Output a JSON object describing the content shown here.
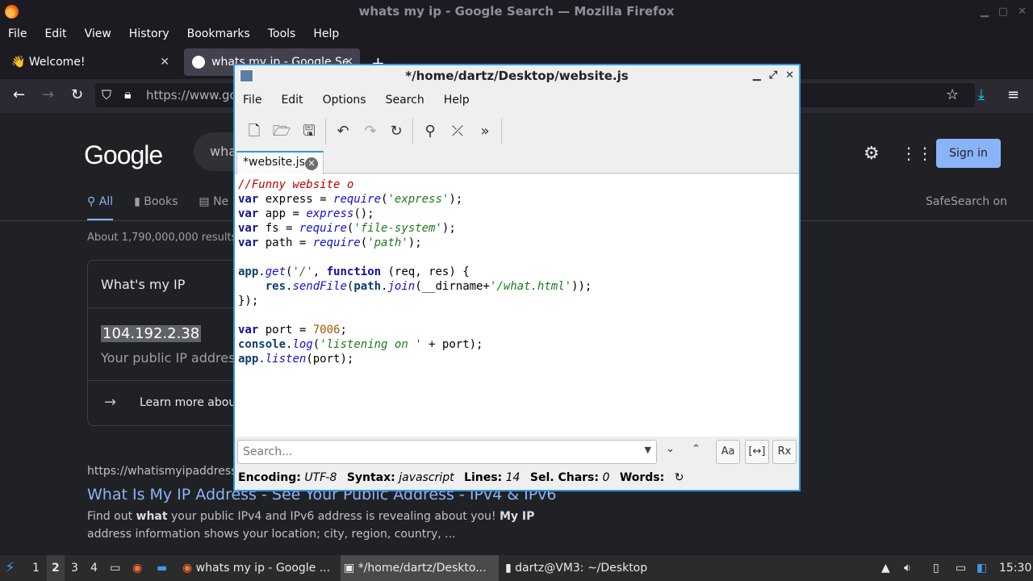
{
  "firefox": {
    "window_title": "whats my ip - Google Search — Mozilla Firefox",
    "menu": [
      "File",
      "Edit",
      "View",
      "History",
      "Bookmarks",
      "Tools",
      "Help"
    ],
    "tabs": [
      {
        "label": "👋 Welcome!"
      },
      {
        "label": "whats my ip - Google Se"
      }
    ],
    "url": "https://www.goo"
  },
  "google": {
    "logo": "Google",
    "search_value": "wha",
    "sign_in": "Sign in",
    "tabs": [
      "All",
      "Books",
      "Ne"
    ],
    "safesearch": "SafeSearch on",
    "results_count": "About 1,790,000,000 results",
    "card": {
      "title": "What's my IP",
      "ip": "104.192.2.38",
      "subtitle": "Your public IP address",
      "learn_more": "Learn more about"
    },
    "result": {
      "url": "https://whatismyipaddress.co",
      "title": "What Is My IP Address - See Your Public Address - IPv4 & IPv6",
      "snippet_parts": [
        "Find out ",
        "what",
        " your public IPv4 and IPv6 address is revealing about you! ",
        "My IP",
        " address information shows your location; city, region, country, ..."
      ]
    }
  },
  "editor": {
    "title": "*/home/dartz/Desktop/website.js",
    "menu": [
      "File",
      "Edit",
      "Options",
      "Search",
      "Help"
    ],
    "tab_label": "*website.js",
    "code_lines": [
      [
        {
          "t": "cm",
          "v": "//Funny website o"
        }
      ],
      [
        {
          "t": "kw",
          "v": "var"
        },
        {
          "t": "",
          "v": " express = "
        },
        {
          "t": "fn",
          "v": "require"
        },
        {
          "t": "",
          "v": "("
        },
        {
          "t": "st",
          "v": "'express'"
        },
        {
          "t": "",
          "v": ");"
        }
      ],
      [
        {
          "t": "kw",
          "v": "var"
        },
        {
          "t": "",
          "v": " app = "
        },
        {
          "t": "fn",
          "v": "express"
        },
        {
          "t": "",
          "v": "();"
        }
      ],
      [
        {
          "t": "kw",
          "v": "var"
        },
        {
          "t": "",
          "v": " fs = "
        },
        {
          "t": "fn",
          "v": "require"
        },
        {
          "t": "",
          "v": "("
        },
        {
          "t": "st",
          "v": "'file-system'"
        },
        {
          "t": "",
          "v": ");"
        }
      ],
      [
        {
          "t": "kw",
          "v": "var"
        },
        {
          "t": "",
          "v": " path = "
        },
        {
          "t": "fn",
          "v": "require"
        },
        {
          "t": "",
          "v": "("
        },
        {
          "t": "st",
          "v": "'path'"
        },
        {
          "t": "",
          "v": ");"
        }
      ],
      [],
      [
        {
          "t": "ob",
          "v": "app"
        },
        {
          "t": "",
          "v": "."
        },
        {
          "t": "fn",
          "v": "get"
        },
        {
          "t": "",
          "v": "("
        },
        {
          "t": "st",
          "v": "'/'"
        },
        {
          "t": "",
          "v": ", "
        },
        {
          "t": "kw",
          "v": "function"
        },
        {
          "t": "",
          "v": " (req, res) {"
        }
      ],
      [
        {
          "t": "",
          "v": "    "
        },
        {
          "t": "ob",
          "v": "res"
        },
        {
          "t": "",
          "v": "."
        },
        {
          "t": "fn",
          "v": "sendFile"
        },
        {
          "t": "",
          "v": "("
        },
        {
          "t": "ob",
          "v": "path"
        },
        {
          "t": "",
          "v": "."
        },
        {
          "t": "fn",
          "v": "join"
        },
        {
          "t": "",
          "v": "(__dirname+"
        },
        {
          "t": "st",
          "v": "'/what.html'"
        },
        {
          "t": "",
          "v": "));"
        }
      ],
      [
        {
          "t": "",
          "v": "});"
        }
      ],
      [],
      [
        {
          "t": "kw",
          "v": "var"
        },
        {
          "t": "",
          "v": " port = "
        },
        {
          "t": "nm",
          "v": "7006"
        },
        {
          "t": "",
          "v": ";"
        }
      ],
      [
        {
          "t": "ob",
          "v": "console"
        },
        {
          "t": "",
          "v": "."
        },
        {
          "t": "fn",
          "v": "log"
        },
        {
          "t": "",
          "v": "("
        },
        {
          "t": "st",
          "v": "'listening on '"
        },
        {
          "t": "",
          "v": " + port);"
        }
      ],
      [
        {
          "t": "ob",
          "v": "app"
        },
        {
          "t": "",
          "v": "."
        },
        {
          "t": "fn",
          "v": "listen"
        },
        {
          "t": "",
          "v": "(port);"
        }
      ]
    ],
    "search_placeholder": "Search...",
    "status": {
      "encoding_label": "Encoding:",
      "encoding": "UTF-8",
      "syntax_label": "Syntax:",
      "syntax": "javascript",
      "lines_label": "Lines:",
      "lines": "14",
      "selchars_label": "Sel. Chars:",
      "selchars": "0",
      "words_label": "Words:"
    },
    "search_buttons": [
      "Aa",
      "[↔]",
      "Rx"
    ]
  },
  "taskbar": {
    "workspaces": [
      "1",
      "2",
      "3",
      "4"
    ],
    "tasks": [
      {
        "label": "whats my ip - Google ..."
      },
      {
        "label": "*/home/dartz/Deskto..."
      },
      {
        "label": "dartz@VM3: ~/Desktop"
      }
    ],
    "clock": "15:30"
  },
  "colors": {
    "accent": "#3399dd",
    "google_link": "#8ab4f8",
    "firefox_bg": "#1c1b22"
  }
}
